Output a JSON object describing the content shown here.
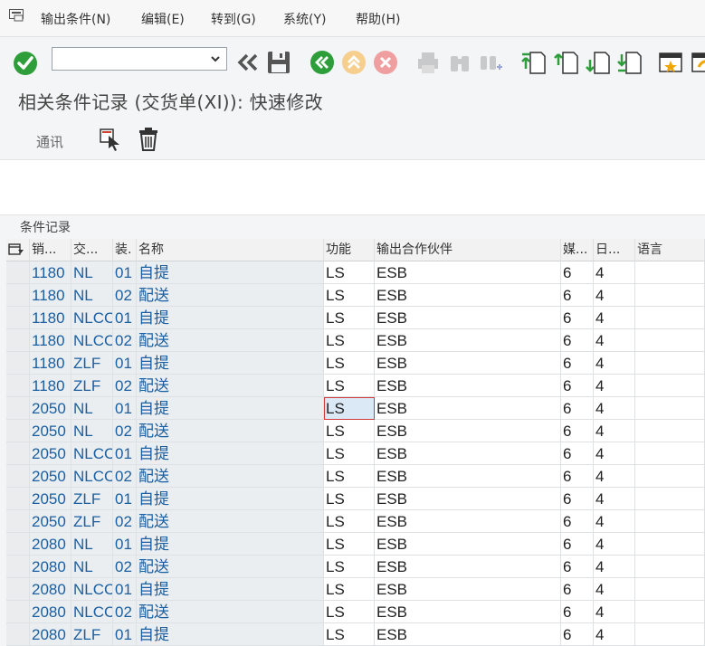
{
  "menu": {
    "items": [
      "输出条件(N)",
      "编辑(E)",
      "转到(G)",
      "系统(Y)",
      "帮助(H)"
    ]
  },
  "toolbar": {
    "command_value": "",
    "icons": [
      "enter-icon",
      "back-double-icon",
      "save-icon",
      "back-icon",
      "exit-icon",
      "cancel-icon",
      "print-icon",
      "find-icon",
      "find-next-icon",
      "first-page-icon",
      "prev-page-icon",
      "next-page-icon",
      "last-page-icon",
      "create-session-icon",
      "generate-shortcut-icon"
    ]
  },
  "title": "相关条件记录 (交货单(XI)): 快速修改",
  "app_toolbar": {
    "comm_label": "通讯"
  },
  "table": {
    "caption": "条件记录",
    "headers": [
      "销...",
      "交...",
      "装.",
      "名称",
      "功能",
      "输出合作伙伴",
      "媒...",
      "日...",
      "语言"
    ],
    "rows": [
      [
        "1180",
        "NL",
        "01",
        "自提",
        "LS",
        "ESB",
        "6",
        "4",
        ""
      ],
      [
        "1180",
        "NL",
        "02",
        "配送",
        "LS",
        "ESB",
        "6",
        "4",
        ""
      ],
      [
        "1180",
        "NLCC",
        "01",
        "自提",
        "LS",
        "ESB",
        "6",
        "4",
        ""
      ],
      [
        "1180",
        "NLCC",
        "02",
        "配送",
        "LS",
        "ESB",
        "6",
        "4",
        ""
      ],
      [
        "1180",
        "ZLF",
        "01",
        "自提",
        "LS",
        "ESB",
        "6",
        "4",
        ""
      ],
      [
        "1180",
        "ZLF",
        "02",
        "配送",
        "LS",
        "ESB",
        "6",
        "4",
        ""
      ],
      [
        "2050",
        "NL",
        "01",
        "自提",
        "LS",
        "ESB",
        "6",
        "4",
        ""
      ],
      [
        "2050",
        "NL",
        "02",
        "配送",
        "LS",
        "ESB",
        "6",
        "4",
        ""
      ],
      [
        "2050",
        "NLCC",
        "01",
        "自提",
        "LS",
        "ESB",
        "6",
        "4",
        ""
      ],
      [
        "2050",
        "NLCC",
        "02",
        "配送",
        "LS",
        "ESB",
        "6",
        "4",
        ""
      ],
      [
        "2050",
        "ZLF",
        "01",
        "自提",
        "LS",
        "ESB",
        "6",
        "4",
        ""
      ],
      [
        "2050",
        "ZLF",
        "02",
        "配送",
        "LS",
        "ESB",
        "6",
        "4",
        ""
      ],
      [
        "2080",
        "NL",
        "01",
        "自提",
        "LS",
        "ESB",
        "6",
        "4",
        ""
      ],
      [
        "2080",
        "NL",
        "02",
        "配送",
        "LS",
        "ESB",
        "6",
        "4",
        ""
      ],
      [
        "2080",
        "NLCC",
        "01",
        "自提",
        "LS",
        "ESB",
        "6",
        "4",
        ""
      ],
      [
        "2080",
        "NLCC",
        "02",
        "配送",
        "LS",
        "ESB",
        "6",
        "4",
        ""
      ],
      [
        "2080",
        "ZLF",
        "01",
        "自提",
        "LS",
        "ESB",
        "6",
        "4",
        ""
      ]
    ],
    "focused_cell": {
      "row": 6,
      "col": 4
    }
  },
  "colors": {
    "key_text": "#1b5fa0",
    "enter_green": "#2e9e3a",
    "nav_green": "#2e9e3a",
    "focus_red": "#d23b3b"
  }
}
